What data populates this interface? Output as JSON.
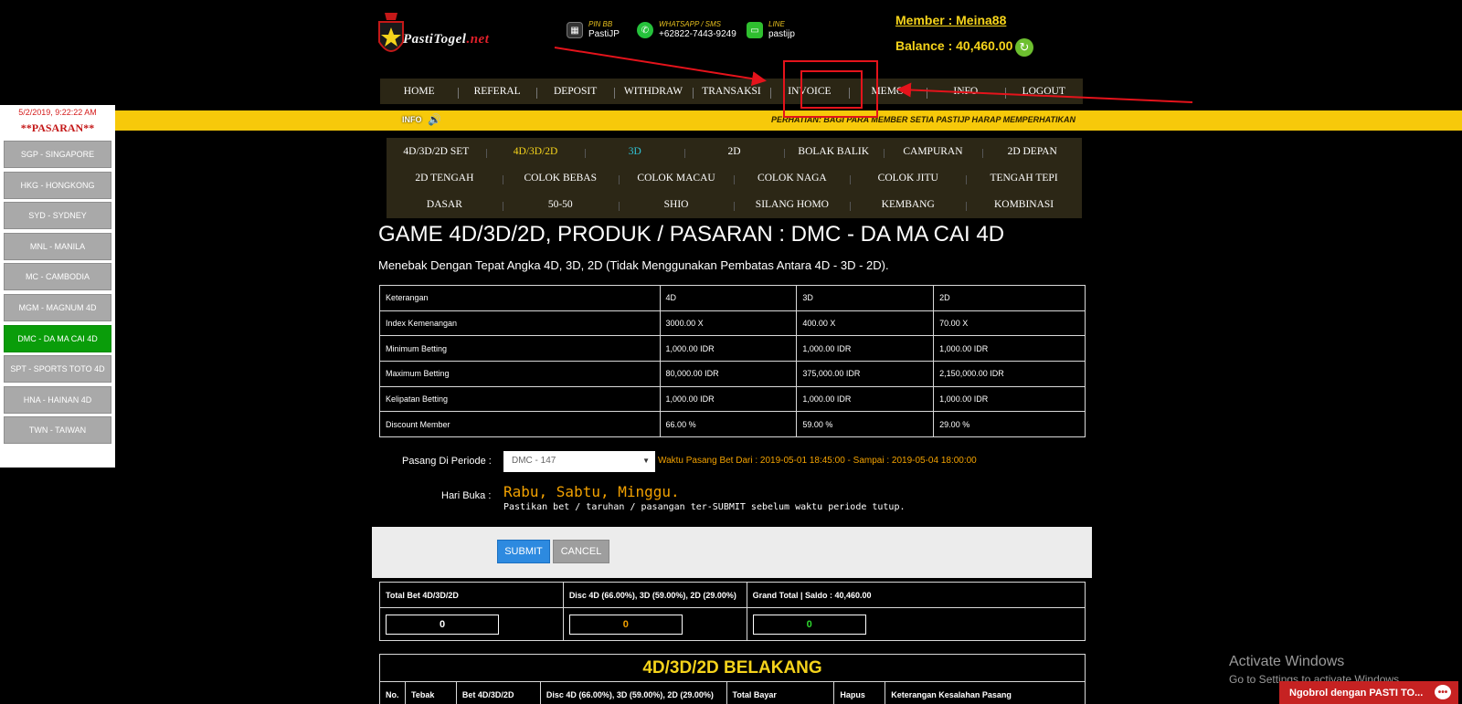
{
  "header": {
    "logo_text": "PastiTogel",
    "logo_suffix": ".net",
    "contacts": [
      {
        "icon": "bbm-icon",
        "label": "PIN BB",
        "value": "PastiJP"
      },
      {
        "icon": "whatsapp-icon",
        "label": "WHATSAPP / SMS",
        "value": "+62822-7443-9249"
      },
      {
        "icon": "line-icon",
        "label": "LINE",
        "value": "pastijp"
      }
    ],
    "member": "Member : Meina88",
    "balance": "Balance : 40,460.00"
  },
  "main_nav": [
    "HOME",
    "REFERAL",
    "DEPOSIT",
    "WITHDRAW",
    "TRANSAKSI",
    "INVOICE",
    "MEMO",
    "INFO",
    "LOGOUT"
  ],
  "info_bar": {
    "label": "INFO",
    "marquee": "PERHATIAN: BAGI PARA MEMBER SETIA PASTIJP HARAP MEMPERHATIKAN"
  },
  "sidebar": {
    "datetime": "5/2/2019, 9:22:22 AM",
    "title": "**PASARAN**",
    "items": [
      "SGP - SINGAPORE",
      "HKG - HONGKONG",
      "SYD - SYDNEY",
      "MNL - MANILA",
      "MC - CAMBODIA",
      "MGM - MAGNUM 4D",
      "DMC - DA MA CAI 4D",
      "SPT - SPORTS TOTO 4D",
      "HNA - HAINAN 4D",
      "TWN - TAIWAN"
    ],
    "active": "DMC - DA MA CAI 4D"
  },
  "sub_nav": [
    [
      "4D/3D/2D SET",
      "4D/3D/2D",
      "3D",
      "2D",
      "BOLAK BALIK",
      "CAMPURAN",
      "2D DEPAN"
    ],
    [
      "2D TENGAH",
      "COLOK BEBAS",
      "COLOK MACAU",
      "COLOK NAGA",
      "COLOK JITU",
      "TENGAH TEPI"
    ],
    [
      "DASAR",
      "50-50",
      "SHIO",
      "SILANG HOMO",
      "KEMBANG",
      "KOMBINASI"
    ]
  ],
  "game": {
    "title": "GAME 4D/3D/2D, PRODUK / PASARAN : DMC - DA MA CAI 4D",
    "description": "Menebak Dengan Tepat Angka 4D, 3D, 2D (Tidak Menggunakan Pembatas Antara 4D - 3D - 2D)."
  },
  "info_table": {
    "headers": [
      "Keterangan",
      "4D",
      "3D",
      "2D"
    ],
    "rows": [
      [
        "Index Kemenangan",
        "3000.00 X",
        "400.00 X",
        "70.00 X"
      ],
      [
        "Minimum Betting",
        "1,000.00 IDR",
        "1,000.00 IDR",
        "1,000.00 IDR"
      ],
      [
        "Maximum Betting",
        "80,000.00 IDR",
        "375,000.00 IDR",
        "2,150,000.00 IDR"
      ],
      [
        "Kelipatan Betting",
        "1,000.00 IDR",
        "1,000.00 IDR",
        "1,000.00 IDR"
      ],
      [
        "Discount Member",
        "66.00 %",
        "59.00 %",
        "29.00 %"
      ]
    ]
  },
  "form": {
    "periode_label": "Pasang Di Periode :",
    "periode_value": "DMC - 147",
    "waktu": "Waktu Pasang Bet Dari : 2019-05-01 18:45:00 - Sampai : 2019-05-04 18:00:00",
    "hari_label": "Hari Buka :",
    "hari_value": "Rabu, Sabtu, Minggu.",
    "hari_note": "Pastikan bet / taruhan / pasangan ter-SUBMIT sebelum waktu periode tutup.",
    "submit": "SUBMIT",
    "cancel": "CANCEL"
  },
  "totals": {
    "headers": [
      "Total Bet 4D/3D/2D",
      "Disc 4D (66.00%), 3D (59.00%), 2D (29.00%)",
      "Grand Total | Saldo : 40,460.00"
    ],
    "values": [
      "0",
      "0",
      "0"
    ],
    "colors": [
      "#ffffff",
      "#f2a100",
      "#2ed82e"
    ]
  },
  "belakang": {
    "title": "4D/3D/2D BELAKANG",
    "headers": [
      "No.",
      "Tebak",
      "Bet 4D/3D/2D",
      "Disc 4D (66.00%), 3D (59.00%), 2D (29.00%)",
      "Total Bayar",
      "Hapus",
      "Keterangan Kesalahan Pasang"
    ]
  },
  "os": {
    "activate_title": "Activate Windows",
    "activate_sub": "Go to Settings to activate Windows."
  },
  "chat": {
    "label": "Ngobrol dengan PASTI TO..."
  },
  "colors": {
    "accent_yellow": "#f5d31b",
    "info_bar": "#f7c90a",
    "active_green": "#0a9d0a",
    "annotation_red": "#e4131b",
    "submit_blue": "#2d8ae0"
  }
}
